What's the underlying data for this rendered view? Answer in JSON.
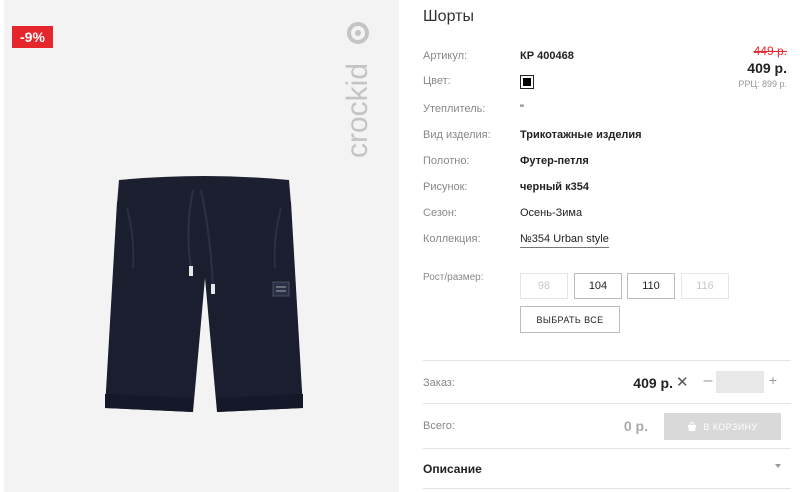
{
  "badge": {
    "discount": "-9%"
  },
  "product": {
    "title": "Шорты"
  },
  "price": {
    "old": "449 р.",
    "current": "409 р.",
    "rrp": "РРЦ: 899 р."
  },
  "attributes": {
    "article_label": "Артикул:",
    "article_value": "КР 400468",
    "color_label": "Цвет:",
    "insulation_label": "Утеплитель:",
    "insulation_value": "\"",
    "type_label": "Вид изделия:",
    "type_value": "Трикотажные изделия",
    "fabric_label": "Полотно:",
    "fabric_value": "Футер-петля",
    "pattern_label": "Рисунок:",
    "pattern_value": "черный к354",
    "season_label": "Сезон:",
    "season_value": "Осень-Зима",
    "collection_label": "Коллекция:",
    "collection_value": "№354 Urban style"
  },
  "swatch_color": "#000000",
  "sizes": {
    "label": "Рост/размер:",
    "options": [
      "98",
      "104",
      "110",
      "116"
    ],
    "select_all": "ВЫБРАТЬ ВСЕ"
  },
  "order": {
    "label": "Заказ:",
    "price": "409 р.",
    "times": "✕",
    "minus": "–",
    "plus": "+",
    "quantity": ""
  },
  "total": {
    "label": "Всего:",
    "value": "0 р.",
    "cart_button": "В КОРЗИНУ"
  },
  "description": {
    "title": "Описание"
  },
  "brand": "crockid",
  "colors": {
    "accent_red": "#e5262d",
    "image_bg": "#f3f3f3",
    "shorts": "#1a1e2e"
  }
}
